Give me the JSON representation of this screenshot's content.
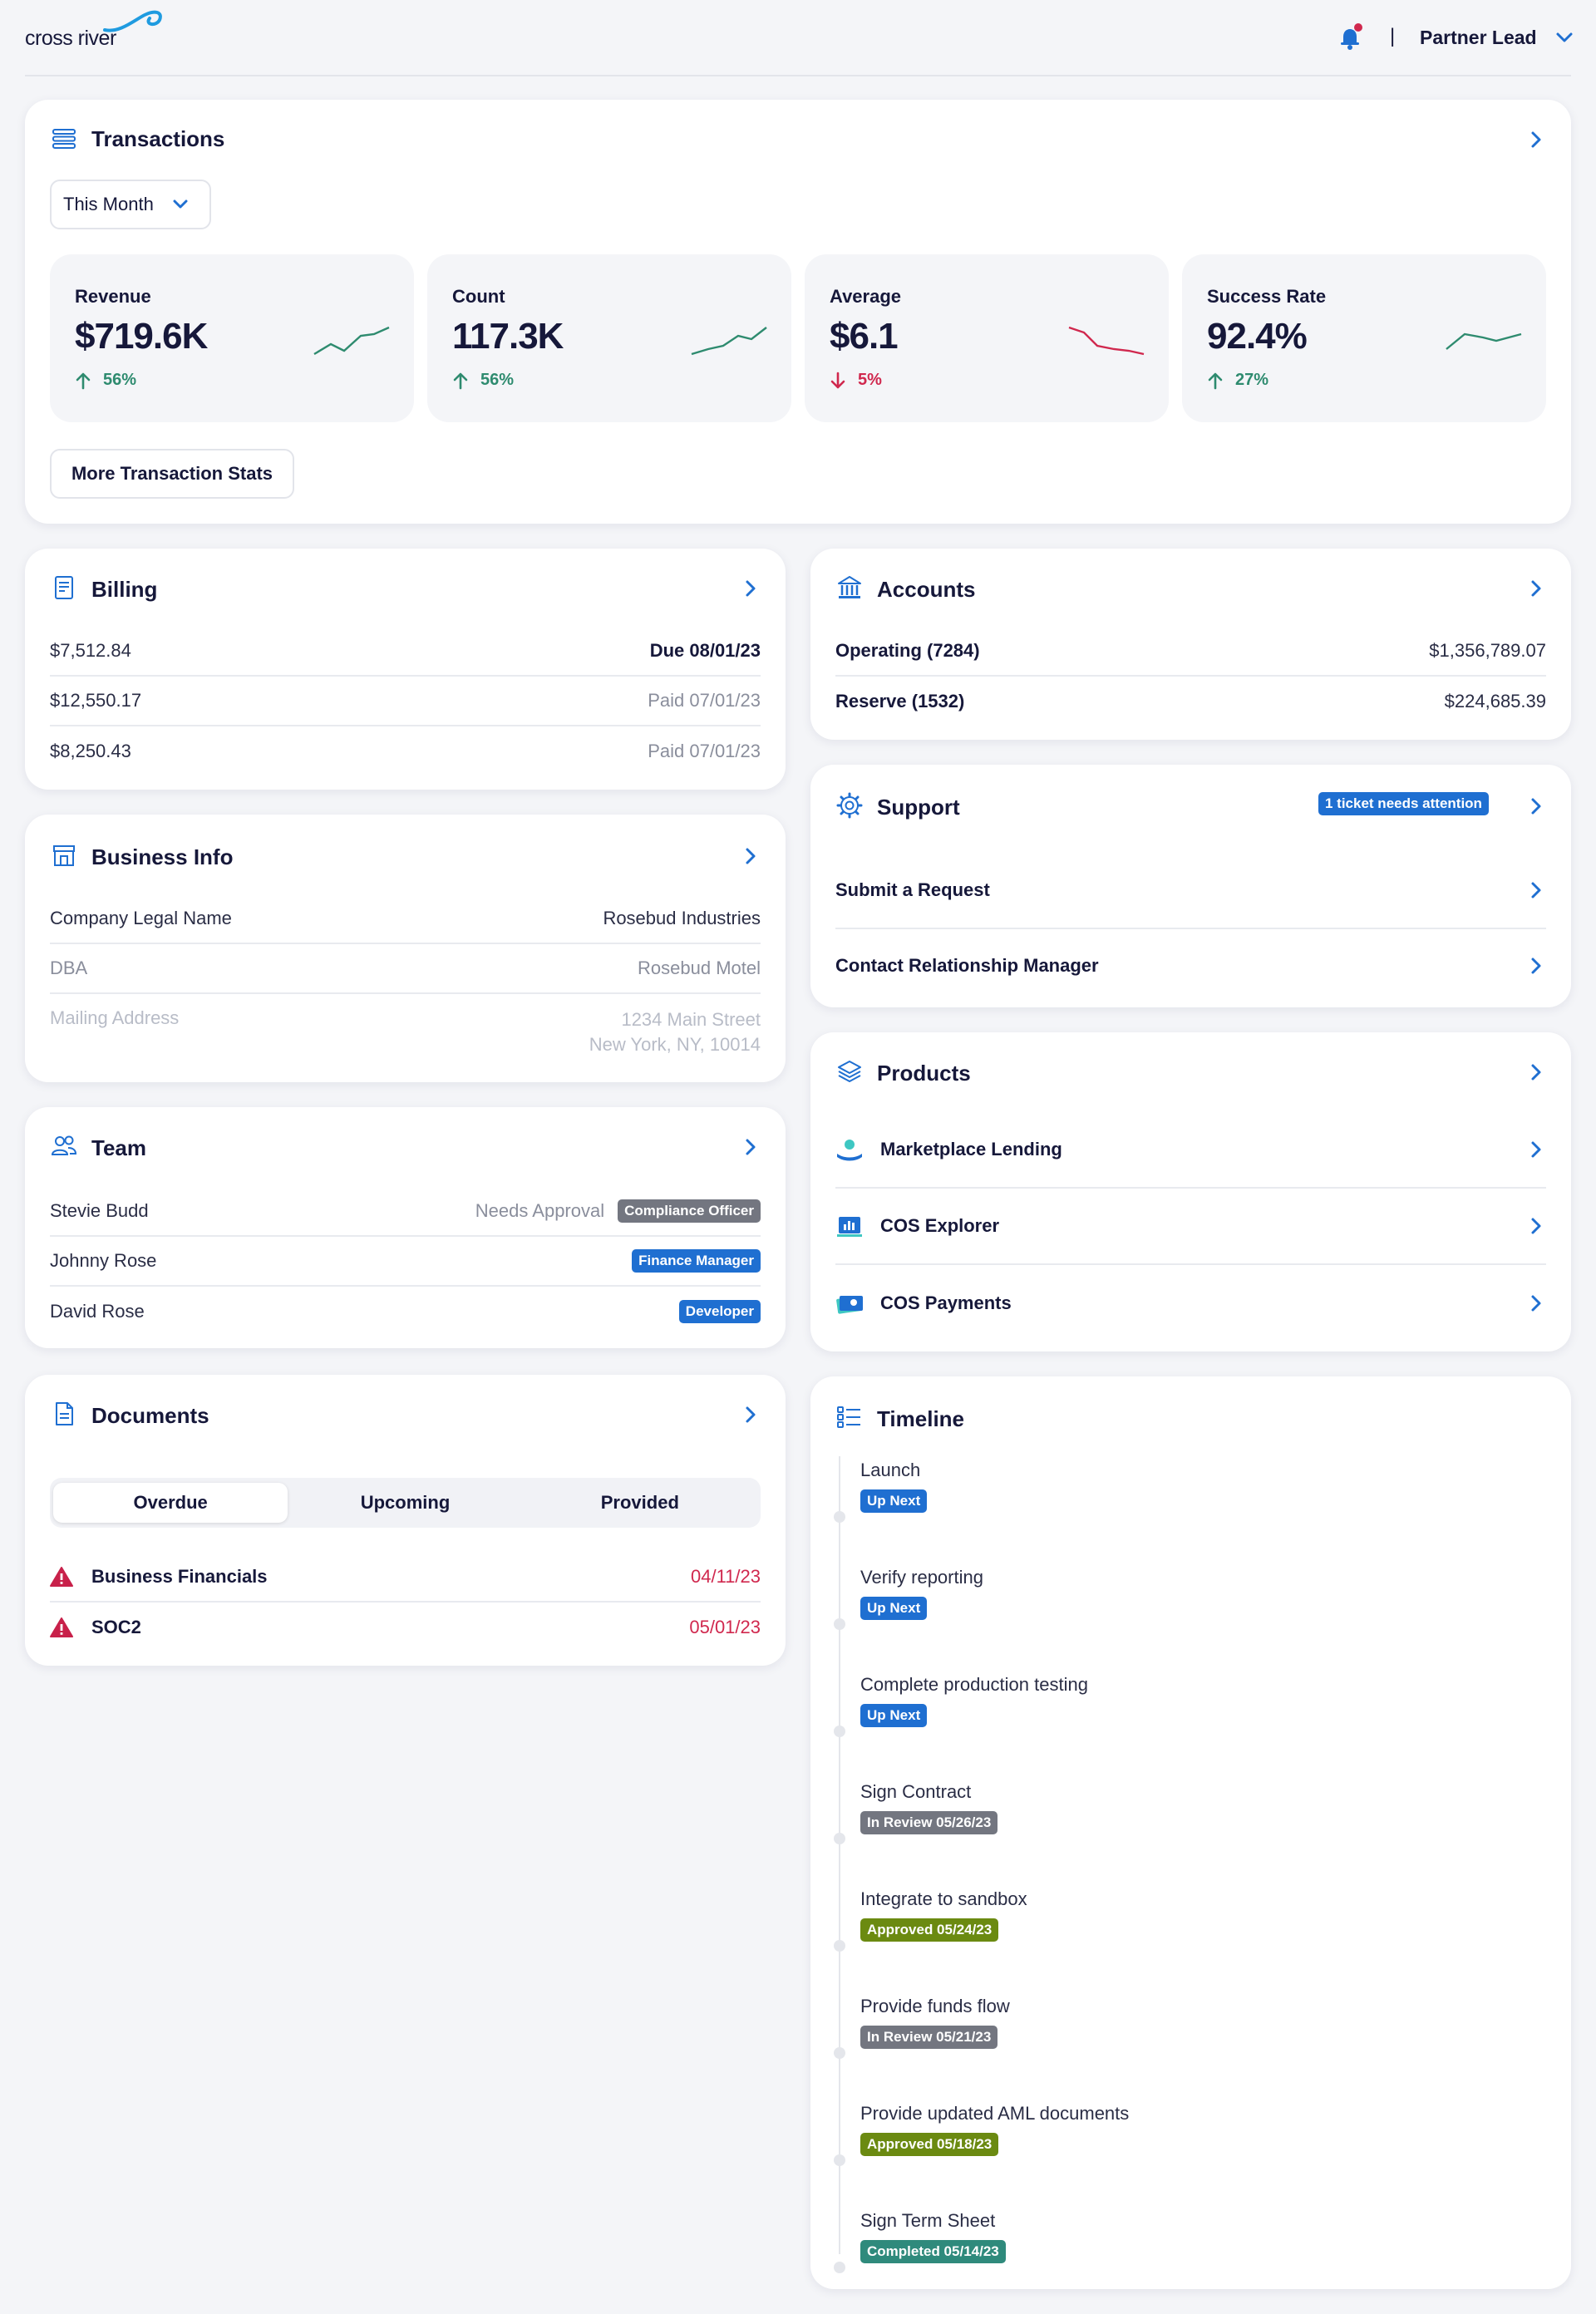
{
  "header": {
    "logo_text": "cross river",
    "user_label": "Partner Lead",
    "separator": "|"
  },
  "transactions": {
    "title": "Transactions",
    "period": "This Month",
    "more_button": "More Transaction Stats",
    "stats": [
      {
        "label": "Revenue",
        "value": "$719.6K",
        "change": "56%",
        "direction": "up"
      },
      {
        "label": "Count",
        "value": "117.3K",
        "change": "56%",
        "direction": "up"
      },
      {
        "label": "Average",
        "value": "$6.1",
        "change": "5%",
        "direction": "down"
      },
      {
        "label": "Success Rate",
        "value": "92.4%",
        "change": "27%",
        "direction": "up"
      }
    ]
  },
  "billing": {
    "title": "Billing",
    "rows": [
      {
        "amount": "$7,512.84",
        "status": "Due 08/01/23"
      },
      {
        "amount": "$12,550.17",
        "status": "Paid 07/01/23"
      },
      {
        "amount": "$8,250.43",
        "status": "Paid 07/01/23"
      }
    ]
  },
  "accounts": {
    "title": "Accounts",
    "rows": [
      {
        "name": "Operating (7284)",
        "balance": "$1,356,789.07"
      },
      {
        "name": "Reserve (1532)",
        "balance": "$224,685.39"
      }
    ]
  },
  "support": {
    "title": "Support",
    "badge": "1 ticket needs attention",
    "items": [
      "Submit a Request",
      "Contact Relationship Manager"
    ]
  },
  "business_info": {
    "title": "Business Info",
    "rows": [
      {
        "label": "Company Legal Name",
        "value": "Rosebud Industries"
      },
      {
        "label": "DBA",
        "value": "Rosebud Motel"
      },
      {
        "label": "Mailing Address",
        "value": "1234 Main Street",
        "value2": "New York, NY, 10014"
      }
    ]
  },
  "products": {
    "title": "Products",
    "items": [
      "Marketplace Lending",
      "COS Explorer",
      "COS Payments"
    ]
  },
  "team": {
    "title": "Team",
    "members": [
      {
        "name": "Stevie Budd",
        "status": "Needs Approval",
        "role": "Compliance Officer"
      },
      {
        "name": "Johnny Rose",
        "status": "",
        "role": "Finance Manager"
      },
      {
        "name": "David Rose",
        "status": "",
        "role": "Developer"
      }
    ]
  },
  "documents": {
    "title": "Documents",
    "tabs": [
      "Overdue",
      "Upcoming",
      "Provided"
    ],
    "active_tab": "Overdue",
    "items": [
      {
        "name": "Business Financials",
        "date": "04/11/23"
      },
      {
        "name": "SOC2",
        "date": "05/01/23"
      }
    ]
  },
  "timeline": {
    "title": "Timeline",
    "items": [
      {
        "title": "Launch",
        "badge": "Up Next",
        "color": "#1f6fd1"
      },
      {
        "title": "Verify reporting",
        "badge": "Up Next",
        "color": "#1f6fd1"
      },
      {
        "title": "Complete production testing",
        "badge": "Up Next",
        "color": "#1f6fd1"
      },
      {
        "title": "Sign Contract",
        "badge": "In Review 05/26/23",
        "color": "#737680"
      },
      {
        "title": "Integrate to sandbox",
        "badge": "Approved 05/24/23",
        "color": "#6b8a11"
      },
      {
        "title": "Provide funds flow",
        "badge": "In Review 05/21/23",
        "color": "#737680"
      },
      {
        "title": "Provide updated AML documents",
        "badge": "Approved 05/18/23",
        "color": "#6b8a11"
      },
      {
        "title": "Sign Term Sheet",
        "badge": "Completed 05/14/23",
        "color": "#2f8a7c"
      }
    ]
  },
  "colors": {
    "brand_blue": "#1f6fd1",
    "up_green": "#2e8b6f",
    "down_red": "#d0284e",
    "notification_dot": "#d0284e"
  }
}
